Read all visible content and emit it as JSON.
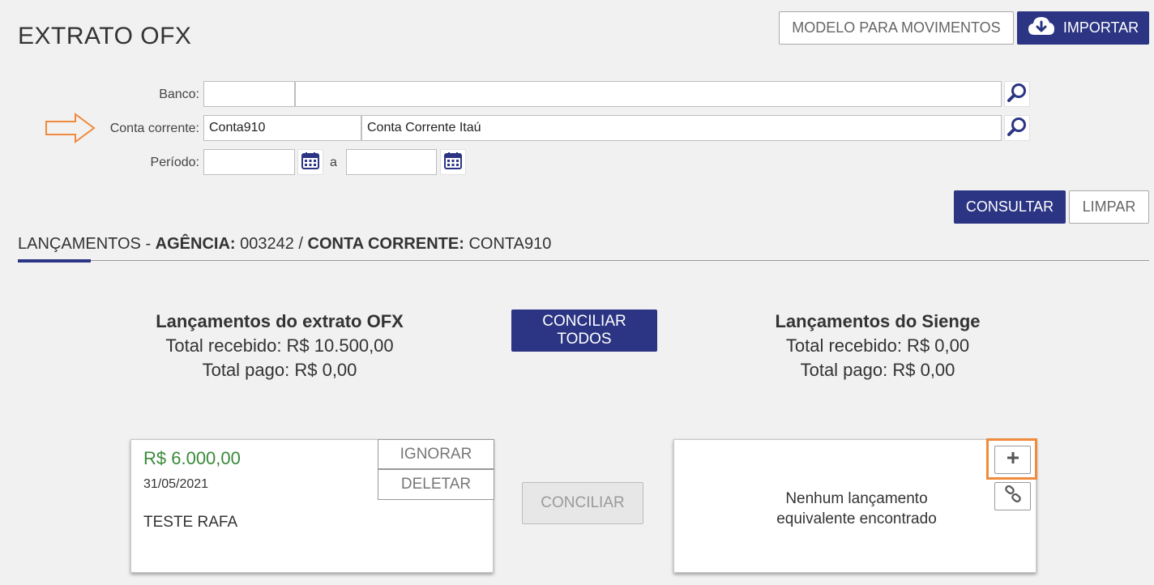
{
  "page": {
    "title": "EXTRATO OFX"
  },
  "header": {
    "modelo_label": "MODELO PARA MOVIMENTOS",
    "importar_label": "IMPORTAR"
  },
  "form": {
    "banco_label": "Banco:",
    "banco_code": "",
    "banco_name": "",
    "conta_label": "Conta corrente:",
    "conta_code": "Conta910",
    "conta_name": "Conta Corrente Itaú",
    "periodo_label": "Período:",
    "periodo_from": "",
    "periodo_sep": "a",
    "periodo_to": ""
  },
  "actions": {
    "consultar_label": "CONSULTAR",
    "limpar_label": "LIMPAR"
  },
  "section": {
    "title": "LANÇAMENTOS -",
    "agencia_label": "AGÊNCIA:",
    "agencia_value": "003242 /",
    "conta_label": "CONTA CORRENTE:",
    "conta_value": "CONTA910"
  },
  "ofx_summary": {
    "heading": "Lançamentos do extrato OFX",
    "recebido": "Total recebido: R$ 10.500,00",
    "pago": "Total pago: R$ 0,00"
  },
  "conciliar_todos": {
    "line1": "CONCILIAR",
    "line2": "TODOS"
  },
  "sienge_summary": {
    "heading": "Lançamentos do Sienge",
    "recebido": "Total recebido: R$ 0,00",
    "pago": "Total pago: R$ 0,00"
  },
  "ofx_entry": {
    "amount": "R$ 6.000,00",
    "date": "31/05/2021",
    "description": "TESTE RAFA",
    "ignorar_label": "IGNORAR",
    "deletar_label": "DELETAR"
  },
  "conciliar_label": "CONCILIAR",
  "sienge_entry": {
    "line1": "Nenhum lançamento",
    "line2": "equivalente encontrado"
  },
  "colors": {
    "primary": "#2b3583",
    "amount_green": "#3a8a3a",
    "highlight_orange": "#f08a3c"
  },
  "icons": [
    "cloud-upload-icon",
    "search-icon",
    "calendar-icon",
    "plus-icon",
    "link-icon",
    "arrow-right-icon"
  ]
}
